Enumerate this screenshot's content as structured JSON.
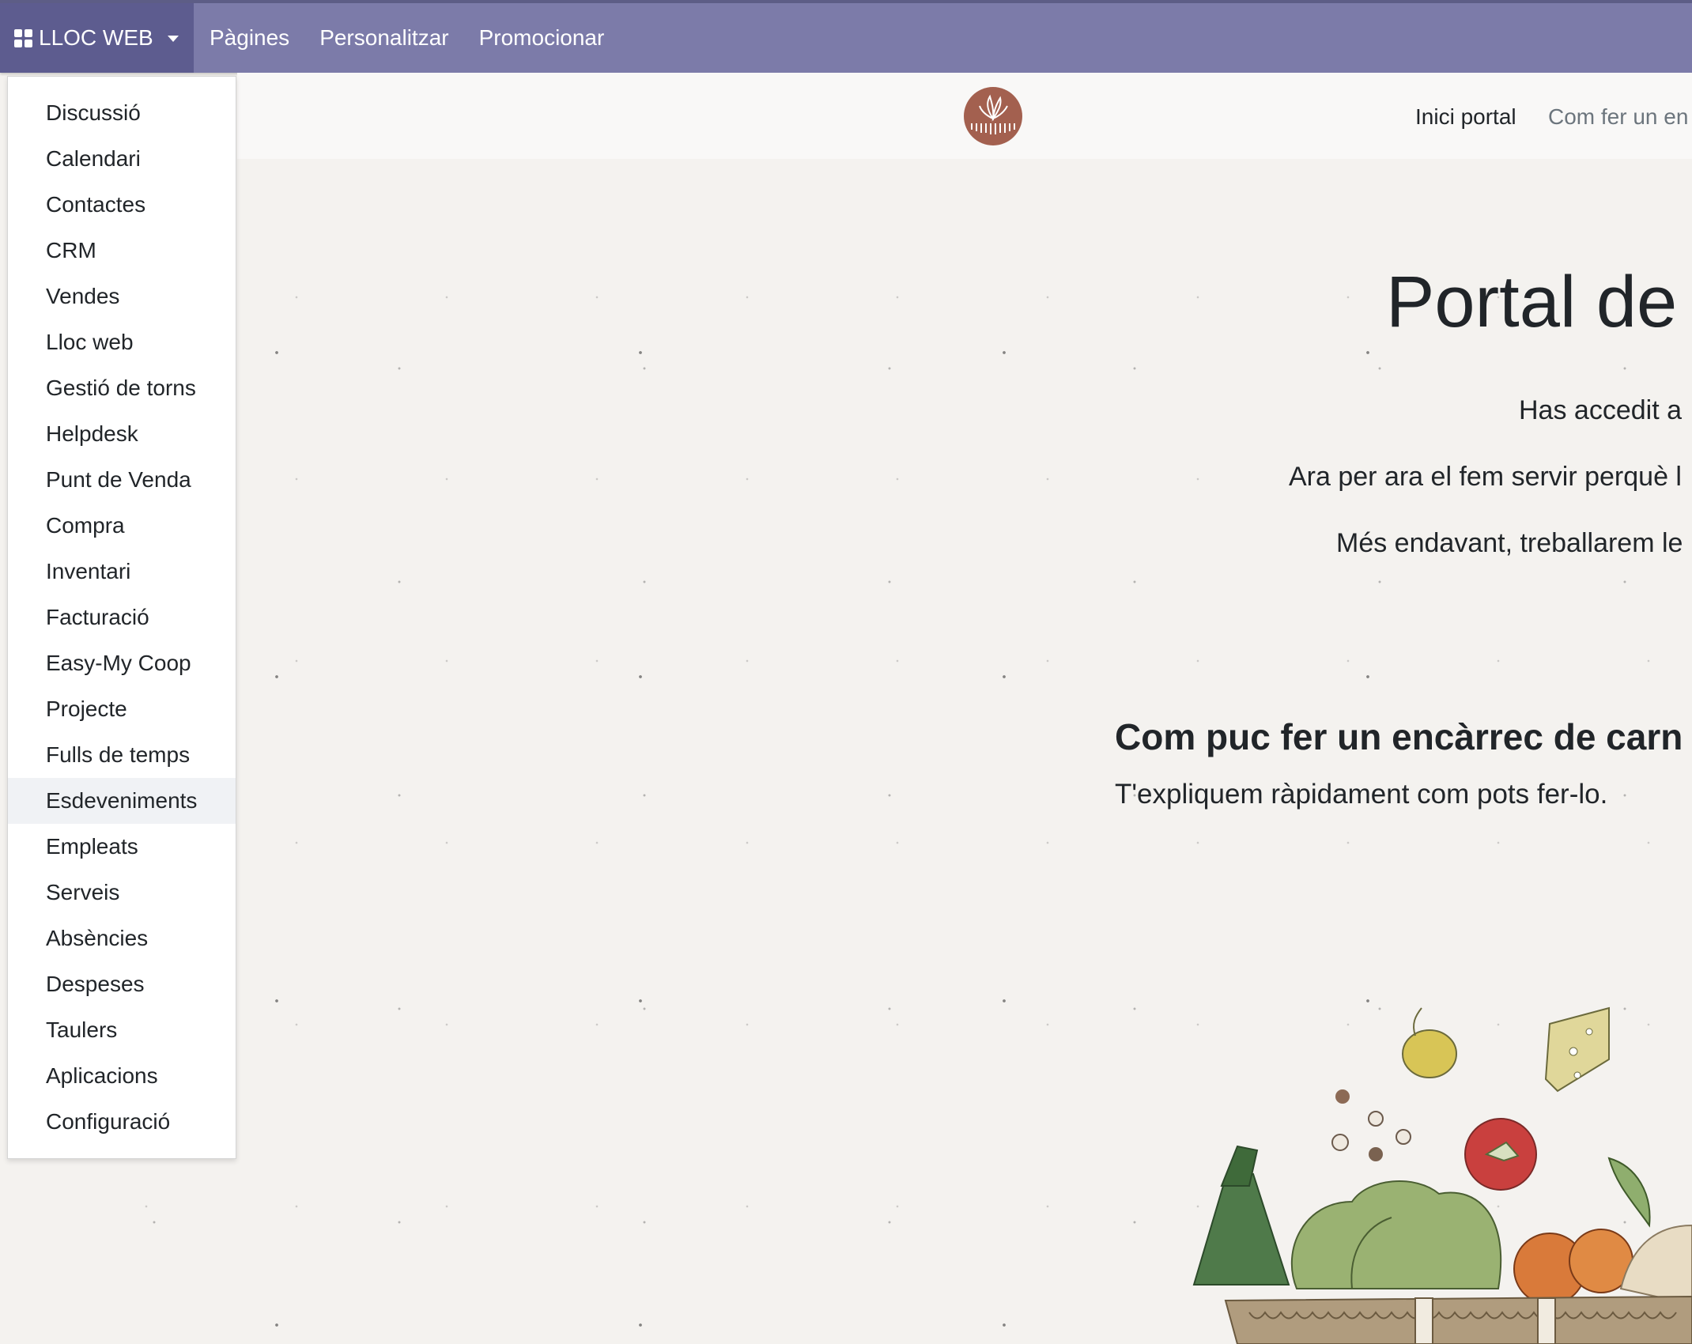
{
  "topbar": {
    "app_label": "LLOC WEB",
    "nav": [
      "Pàgines",
      "Personalitzar",
      "Promocionar"
    ]
  },
  "site_nav": {
    "active": "Inici portal",
    "next": "Com fer un en"
  },
  "hero": {
    "title": "Portal de",
    "line1": "Has accedit a",
    "line2": "Ara per ara el fem servir perquè l",
    "line3": "Més endavant, treballarem le"
  },
  "section": {
    "title": "Com puc fer un encàrrec de carn",
    "subtitle": "T'expliquem ràpidament com pots fer-lo."
  },
  "apps_menu": {
    "items": [
      "Discussió",
      "Calendari",
      "Contactes",
      "CRM",
      "Vendes",
      "Lloc web",
      "Gestió de torns",
      "Helpdesk",
      "Punt de Venda",
      "Compra",
      "Inventari",
      "Facturació",
      "Easy-My Coop",
      "Projecte",
      "Fulls de temps",
      "Esdeveniments",
      "Empleats",
      "Serveis",
      "Absències",
      "Despeses",
      "Taulers",
      "Aplicacions",
      "Configuració"
    ],
    "highlighted": "Esdeveniments"
  },
  "colors": {
    "navbar": "#7c7ba9",
    "navbar_active": "#5d5c8f",
    "logo": "#a3604f",
    "page_bg": "#f4f2ef"
  }
}
